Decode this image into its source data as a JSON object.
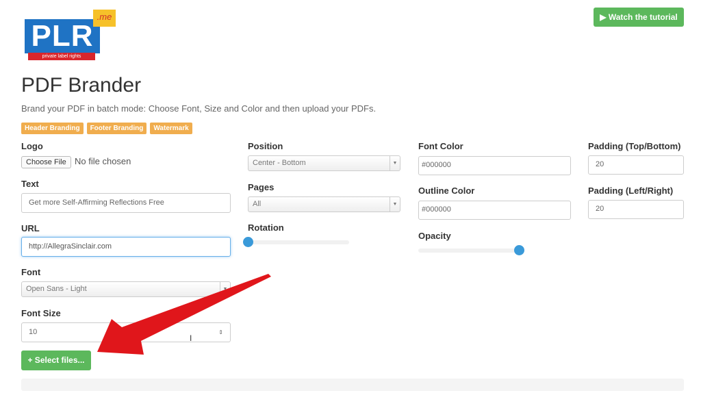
{
  "logo": {
    "text": "PLR",
    "badge": ".me",
    "tagline": "private label rights"
  },
  "header": {
    "tutorial_button": "▶ Watch the tutorial",
    "title": "PDF Brander",
    "subtitle": "Brand your PDF in batch mode: Choose Font, Size and Color and then upload your PDFs."
  },
  "tabs": [
    "Header Branding",
    "Footer Branding",
    "Watermark"
  ],
  "form": {
    "logo": {
      "label": "Logo",
      "button": "Choose File",
      "status": "No file chosen"
    },
    "text": {
      "label": "Text",
      "value": "Get more Self-Affirming Reflections Free"
    },
    "url": {
      "label": "URL",
      "value": "http://AllegraSinclair.com"
    },
    "font": {
      "label": "Font",
      "value": "Open Sans - Light"
    },
    "font_size": {
      "label": "Font Size",
      "value": "10"
    },
    "position": {
      "label": "Position",
      "value": "Center - Bottom"
    },
    "pages": {
      "label": "Pages",
      "value": "All"
    },
    "rotation": {
      "label": "Rotation",
      "value": 0
    },
    "font_color": {
      "label": "Font Color",
      "value": "#000000"
    },
    "outline_color": {
      "label": "Outline Color",
      "value": "#000000"
    },
    "opacity": {
      "label": "Opacity",
      "value": 1
    },
    "padding_tb": {
      "label": "Padding (Top/Bottom)",
      "value": "20"
    },
    "padding_lr": {
      "label": "Padding (Left/Right)",
      "value": "20"
    },
    "select_files": "+ Select files..."
  },
  "colors": {
    "accent_green": "#5cb85c",
    "tag_orange": "#f0ad4e",
    "slider_blue": "#3a9ad9",
    "arrow_red": "#e0161b"
  }
}
